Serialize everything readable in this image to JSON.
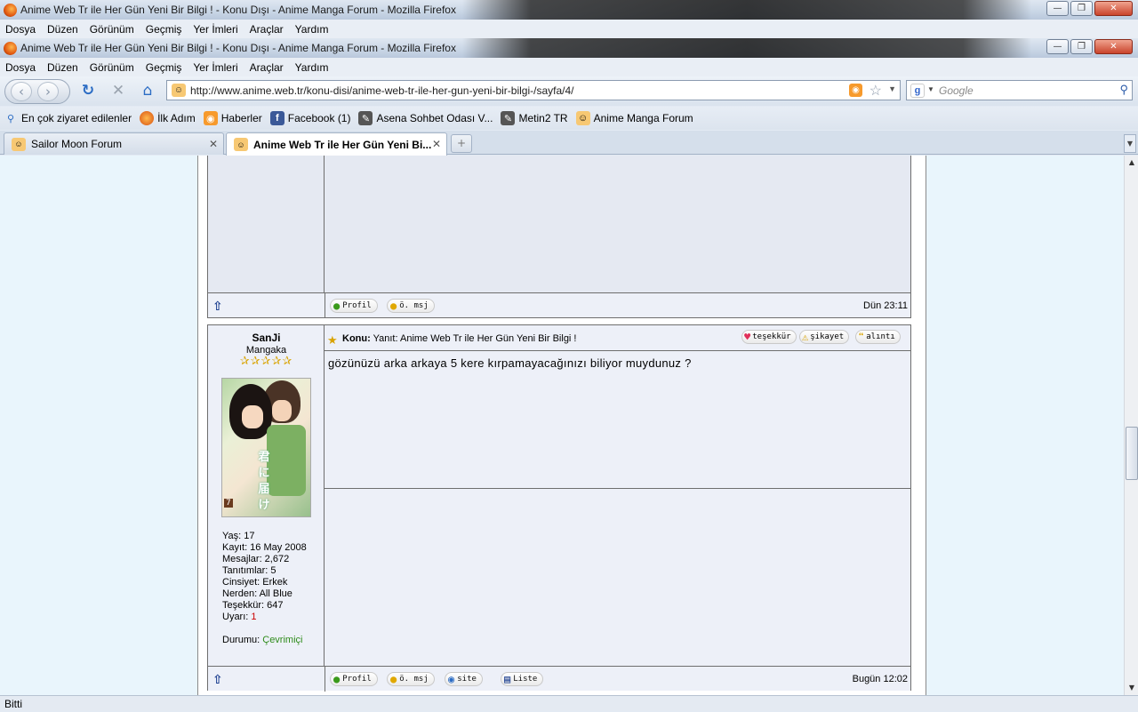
{
  "window": {
    "title": "Anime Web Tr ile Her Gün Yeni Bir Bilgi ! - Konu Dışı - Anime Manga Forum - Mozilla Firefox",
    "minimize": "—",
    "maximize": "❐",
    "close": "✕"
  },
  "menu": [
    "Dosya",
    "Düzen",
    "Görünüm",
    "Geçmiş",
    "Yer İmleri",
    "Araçlar",
    "Yardım"
  ],
  "nav": {
    "url": "http://www.anime.web.tr/konu-disi/anime-web-tr-ile-her-gun-yeni-bir-bilgi-/sayfa/4/",
    "search_placeholder": "Google"
  },
  "bookmarks": [
    {
      "label": "En çok ziyaret edilenler",
      "icon": "most-visited-icon"
    },
    {
      "label": "İlk Adım",
      "icon": "firefox-icon"
    },
    {
      "label": "Haberler",
      "icon": "rss-icon"
    },
    {
      "label": "Facebook (1)",
      "icon": "facebook-icon"
    },
    {
      "label": "Asena Sohbet Odası V...",
      "icon": "chat-icon"
    },
    {
      "label": "Metin2 TR",
      "icon": "game-icon"
    },
    {
      "label": "Anime Manga Forum",
      "icon": "forum-icon"
    }
  ],
  "tabs": [
    {
      "label": "Sailor Moon Forum",
      "active": false
    },
    {
      "label": "Anime Web Tr ile Her Gün Yeni Bi...",
      "active": true
    }
  ],
  "post1": {
    "profile_btn": "Profil",
    "pm_btn": "ö. msj",
    "time": "Dün 23:11"
  },
  "post2": {
    "username": "SanJi",
    "rank": "Mangaka",
    "stars": "✰✰✰✰✰",
    "avatar_kanji": "君に届け",
    "avatar_volume": "7",
    "info": {
      "age": "Yaş: 17",
      "registered": "Kayıt: 16 May 2008",
      "messages": "Mesajlar: 2,672",
      "reputation": "Tanıtımlar: 5",
      "gender": "Cinsiyet: Erkek",
      "location": "Nerden: All Blue",
      "thanks": "Teşekkür: 647",
      "warning_label": "Uyarı: ",
      "warning_value": "1",
      "status_label": "Durumu: ",
      "status_value": "Çevrimiçi"
    },
    "subject_label": "Konu:",
    "subject": " Yanıt: Anime Web Tr ile Her Gün Yeni Bir Bilgi !",
    "thanks_btn": "teşekkür",
    "report_btn": "şikayet",
    "quote_btn": "alıntı",
    "message": "gözünüzü arka arkaya 5 kere kırpamayacağınızı biliyor muydunuz ?",
    "profile_btn": "Profil",
    "pm_btn": "ö. msj",
    "site_btn": "site",
    "list_btn": "Liste",
    "time": "Bugün 12:02"
  },
  "status": "Bitti"
}
